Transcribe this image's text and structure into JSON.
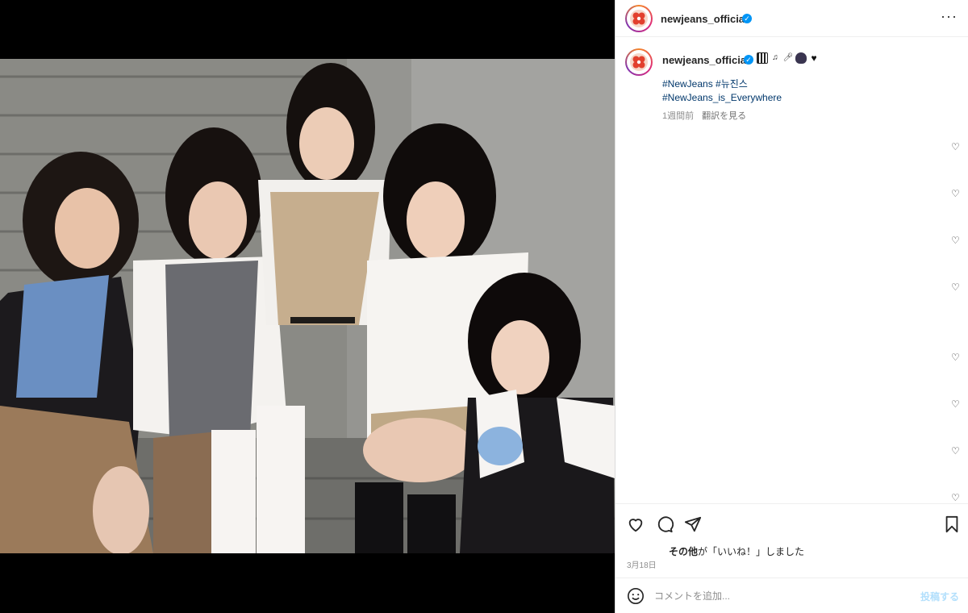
{
  "account": {
    "username": "newjeans_official",
    "verified_icon": "verified-badge-icon",
    "avatar_icon": "newjeans-clover-logo"
  },
  "caption": {
    "emojis": [
      "piano-keys-emoji",
      "music-notes-emoji",
      "microphone-emoji",
      "bunny-emoji",
      "black-heart-emoji"
    ],
    "hashtags_line1": "#NewJeans #뉴진스",
    "hashtags_line2": "#NewJeans_is_Everywhere",
    "time_ago": "1週間前",
    "translate": "翻訳を見る"
  },
  "likes_text": "その他が「いいね！」しました",
  "likes_prefix": "その他",
  "post_date": "3月18日",
  "comment": {
    "placeholder": "コメントを追加...",
    "post_label": "投稿する"
  },
  "colors": {
    "link": "#00376b",
    "accent": "#0095f6",
    "secondary_text": "#8e8e8e"
  },
  "comment_like_icons": [
    "heart-outline-icon",
    "heart-outline-icon",
    "heart-outline-icon",
    "heart-outline-icon",
    "heart-outline-icon",
    "heart-outline-icon",
    "heart-outline-icon",
    "heart-outline-icon"
  ]
}
